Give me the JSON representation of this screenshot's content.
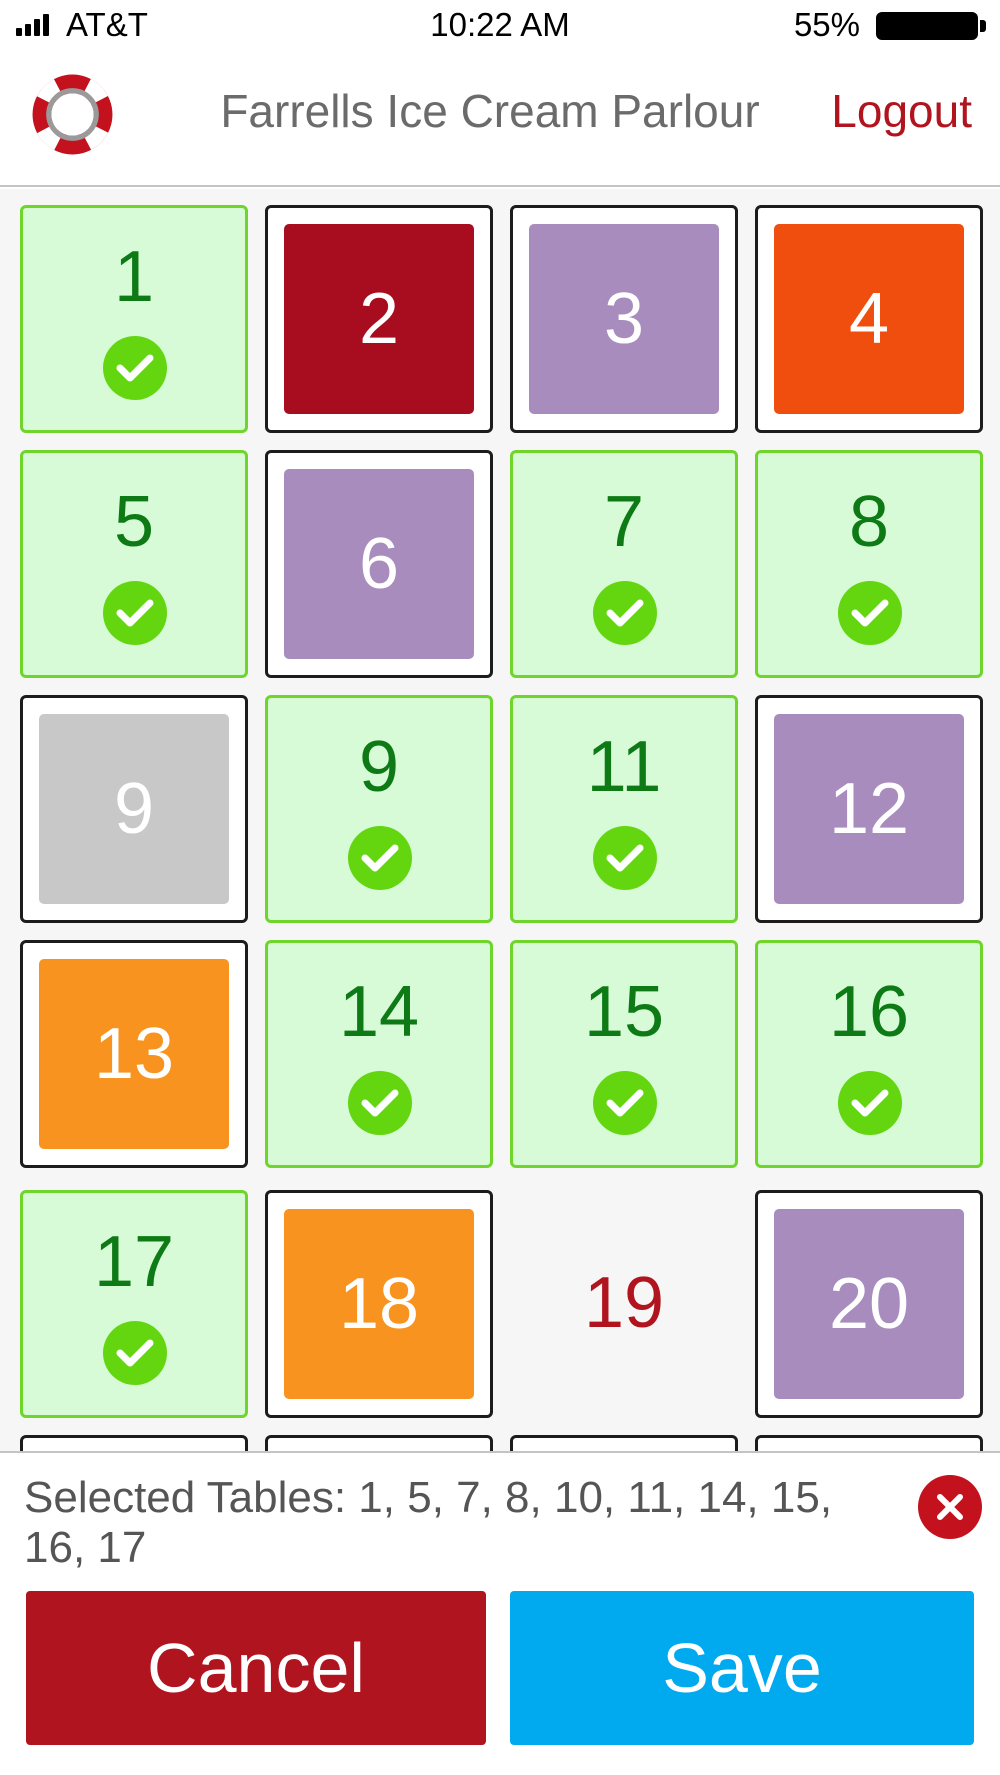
{
  "status_bar": {
    "carrier": "AT&T",
    "time": "10:22 AM",
    "battery": "55%"
  },
  "header": {
    "title": "Farrells Ice Cream Parlour",
    "logout": "Logout",
    "logo_icon": "lifebuoy-icon"
  },
  "colors": {
    "brand_red": "#b0141e",
    "selected_bg": "#d6fbd6",
    "selected_border": "#6fd52a",
    "check": "#63d610",
    "purple": "#a88cbe",
    "orange": "#f7931e",
    "red_orange": "#f04e0e",
    "gray": "#c8c8c8",
    "save_blue": "#01aaef"
  },
  "tables": [
    {
      "label": "1",
      "state": "selected"
    },
    {
      "label": "2",
      "state": "occupied",
      "color": "#a70d1e"
    },
    {
      "label": "3",
      "state": "occupied",
      "color": "#a88cbe"
    },
    {
      "label": "4",
      "state": "occupied",
      "color": "#f04e0e"
    },
    {
      "label": "5",
      "state": "selected"
    },
    {
      "label": "6",
      "state": "occupied",
      "color": "#a88cbe"
    },
    {
      "label": "7",
      "state": "selected"
    },
    {
      "label": "8",
      "state": "selected"
    },
    {
      "label": "9",
      "state": "occupied",
      "color": "#c8c8c8"
    },
    {
      "label": "9",
      "state": "selected"
    },
    {
      "label": "11",
      "state": "selected"
    },
    {
      "label": "12",
      "state": "occupied",
      "color": "#a88cbe"
    },
    {
      "label": "13",
      "state": "occupied",
      "color": "#f7931e"
    },
    {
      "label": "14",
      "state": "selected"
    },
    {
      "label": "15",
      "state": "selected"
    },
    {
      "label": "16",
      "state": "selected"
    },
    {
      "label": "17",
      "state": "selected"
    },
    {
      "label": "18",
      "state": "occupied",
      "color": "#f7931e"
    },
    {
      "label": "19",
      "state": "empty"
    },
    {
      "label": "20",
      "state": "occupied",
      "color": "#a88cbe"
    }
  ],
  "footer": {
    "selected_tables": "Selected Tables: 1, 5, 7, 8, 10, 11, 14, 15, 16, 17",
    "clear_icon": "close-circle-icon",
    "cancel": "Cancel",
    "save": "Save"
  }
}
